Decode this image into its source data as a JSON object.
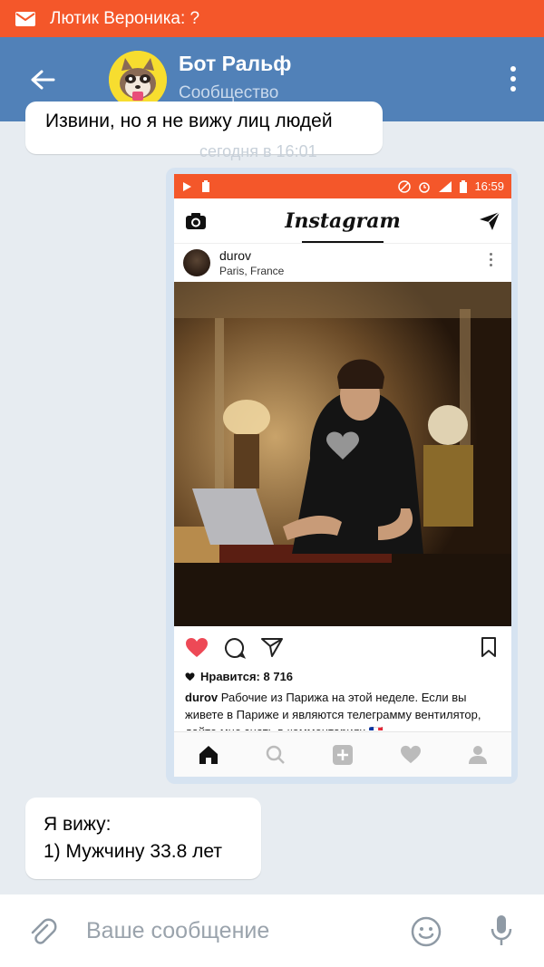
{
  "notification": {
    "text": "Лютик Вероника: ?"
  },
  "header": {
    "title": "Бот Ральф",
    "subtitle": "Сообщество"
  },
  "messages": {
    "first": "Извини, но я не вижу лиц людей",
    "timestamp": "сегодня в 16:01",
    "last": {
      "line1": "Я вижу:",
      "line2": "1) Мужчину 33.8 лет"
    }
  },
  "screenshot": {
    "status_time": "16:59",
    "app_name": "Instagram",
    "post_user": "durov",
    "post_location": "Paris, France",
    "likes_label": "Нравится: 8 716",
    "caption_user": "durov",
    "caption_text": "Рабочие из Парижа на этой неделе. Если вы живете в Париже и являются телеграмму вентилятор, дайте мне знать в комментариях 🇫🇷"
  },
  "composer": {
    "placeholder": "Ваше сообщение"
  },
  "colors": {
    "accent_orange": "#f4572a",
    "vk_blue": "#5181b8",
    "like_red": "#ed4956"
  }
}
